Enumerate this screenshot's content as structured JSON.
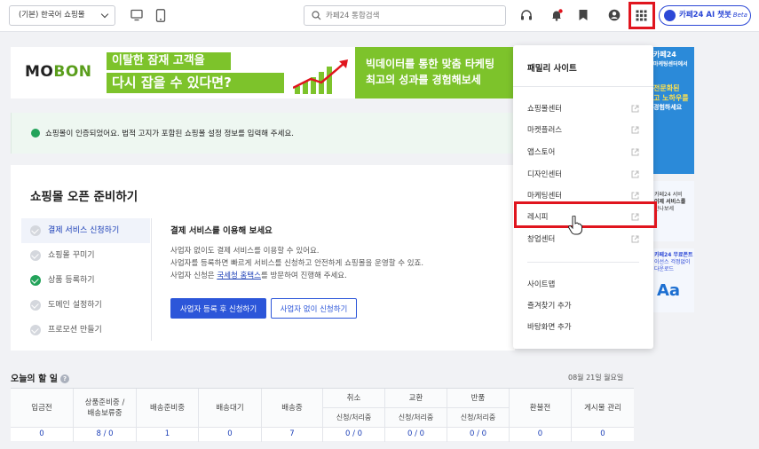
{
  "header": {
    "mall_select": "(기본) 한국어 쇼핑몰",
    "search_placeholder": "카페24 통합검색",
    "chatbot_label": "카페24 AI 챗봇",
    "chatbot_badge": "Beta"
  },
  "banner": {
    "logo_a": "MO",
    "logo_b": "BON",
    "line1": "이탈한 잠재 고객을",
    "line2": "다시 잡을 수 있다면?",
    "right1": "빅데이터를 통한 맞춤 타케팅",
    "right2": "최고의 성과를 경험해보세"
  },
  "notice": {
    "text": "쇼핑몰이 인증되었어요. 법적 고지가 포함된 쇼핑몰 설정 정보를 입력해 주세요."
  },
  "ready": {
    "title": "쇼핑몰 오픈 준비하기",
    "steps": [
      {
        "label": "결제 서비스 신청하기",
        "done": false,
        "active": true
      },
      {
        "label": "쇼핑몰 꾸미기",
        "done": false,
        "active": false
      },
      {
        "label": "상품 등록하기",
        "done": true,
        "active": false
      },
      {
        "label": "도메인 설정하기",
        "done": false,
        "active": false
      },
      {
        "label": "프로모션 만들기",
        "done": false,
        "active": false
      }
    ],
    "content_heading": "결제 서비스를 이용해 보세요",
    "line1": "사업자 없이도 결제 서비스를 이용할 수 있어요.",
    "line2": "사업자를 등록하면 빠르게 서비스를 신청하고 안전하게 쇼핑몰을 운영할 수 있죠.",
    "line3_pre": "사업자 신청은 ",
    "line3_link": "국세청 홈택스",
    "line3_post": "를 방문하여 진행해 주세요.",
    "btn_primary": "사업자 등록 후 신청하기",
    "btn_outline": "사업자 없이 신청하기"
  },
  "todo": {
    "title": "오늘의 할 일",
    "help": "?",
    "date": "08월 21일 월요일",
    "columns": [
      {
        "label": "입금전",
        "value": "0"
      },
      {
        "label": "상품준비중 / 배송보류중",
        "label1": "상품준비중 /",
        "label2": "배송보류중",
        "value": "8 / 0"
      },
      {
        "label": "배송준비중",
        "value": "1"
      },
      {
        "label": "배송대기",
        "value": "0"
      },
      {
        "label": "배송중",
        "value": "7"
      },
      {
        "label": "취소",
        "sub": "신청/처리중",
        "value": "0 / 0"
      },
      {
        "label": "교환",
        "sub": "신청/처리중",
        "value": "0 / 0"
      },
      {
        "label": "반품",
        "sub": "신청/처리중",
        "value": "0 / 0"
      },
      {
        "label": "환불전",
        "value": "0"
      },
      {
        "label": "게시물 관리",
        "value": "0"
      }
    ]
  },
  "ads": {
    "a1_line1": "카페24",
    "a1_line2": "마케팅센터에서",
    "a1_line3": "전문화된",
    "a1_line4": "고 노하우를",
    "a1_line5": "경험하세요",
    "a2_line1": "카페24 서비",
    "a2_line2": "이제 서비스를",
    "a2_line3": "만나보세",
    "a3_line1": "카페24 무료폰트",
    "a3_line2": "이선스 걱정없이",
    "a3_line3": "다운로드",
    "a3_aa": "Aa"
  },
  "dropdown": {
    "title": "패밀리 사이트",
    "items": [
      {
        "label": "쇼핑몰센터",
        "external": true
      },
      {
        "label": "마켓플러스",
        "external": true
      },
      {
        "label": "앱스토어",
        "external": true
      },
      {
        "label": "디자인센터",
        "external": true
      },
      {
        "label": "마케팅센터",
        "external": true
      },
      {
        "label": "레시피",
        "external": true
      },
      {
        "label": "창업센터",
        "external": true
      }
    ],
    "extra": [
      {
        "label": "사이트맵"
      },
      {
        "label": "즐겨찾기 추가"
      },
      {
        "label": "바탕화면 추가"
      }
    ]
  },
  "colors": {
    "accent": "#2c56d9",
    "highlight": "#e0151e",
    "success": "#23a35a",
    "banner_green": "#7dc32b"
  }
}
